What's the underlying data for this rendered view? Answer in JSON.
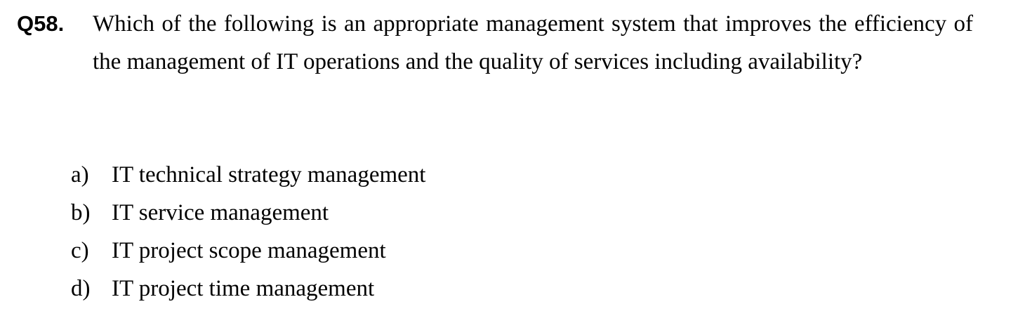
{
  "question": {
    "number": "Q58.",
    "text": "Which of the following is an appropriate management system that improves the efficiency of the management of IT operations and the quality of services including availability?"
  },
  "options": [
    {
      "letter": "a)",
      "text": "IT technical strategy management"
    },
    {
      "letter": "b)",
      "text": "IT service management"
    },
    {
      "letter": "c)",
      "text": "IT project scope management"
    },
    {
      "letter": "d)",
      "text": "IT project time management"
    }
  ]
}
